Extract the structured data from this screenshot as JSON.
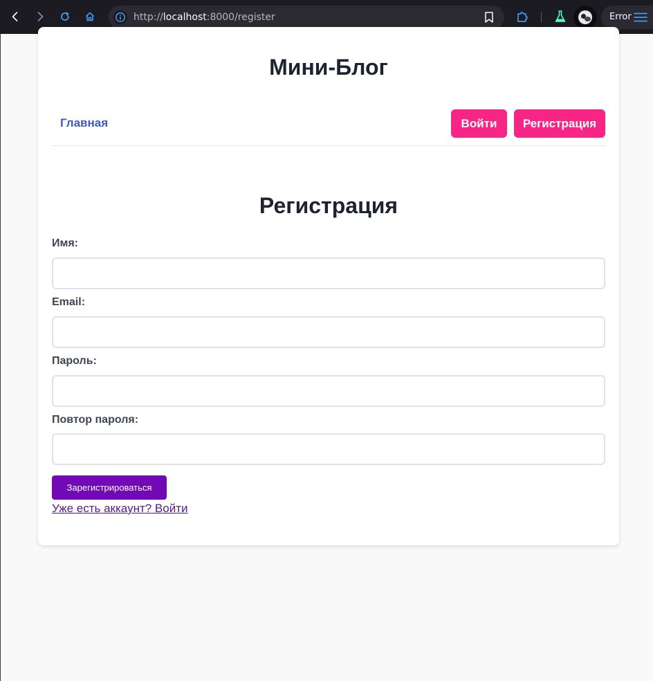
{
  "browser": {
    "url_scheme": "http://",
    "url_host": "localhost",
    "url_path": ":8000/register",
    "error_label": "Error",
    "icons": {
      "back": "chevron-left-icon",
      "forward": "chevron-right-icon",
      "reload": "reload-icon",
      "home": "home-icon",
      "info": "info-icon",
      "bookmark": "bookmark-icon",
      "extensions": "puzzle-icon",
      "lab": "flask-icon",
      "menu": "hamburger-menu-icon"
    }
  },
  "site": {
    "title": "Мини-Блог",
    "nav": {
      "home": "Главная",
      "login": "Войти",
      "register": "Регистрация"
    }
  },
  "form": {
    "title": "Регистрация",
    "fields": [
      {
        "label": "Имя:",
        "value": ""
      },
      {
        "label": "Email:",
        "value": ""
      },
      {
        "label": "Пароль:",
        "value": ""
      },
      {
        "label": "Повтор пароля:",
        "value": ""
      }
    ],
    "submit": "Зарегистрироваться",
    "login_link": "Уже есть аккаунт? Войти"
  },
  "colors": {
    "accent_pink": "#f72585",
    "submit_purple": "#7209b7",
    "nav_link_blue": "#3f57c8",
    "visited_link": "#551a8b"
  }
}
